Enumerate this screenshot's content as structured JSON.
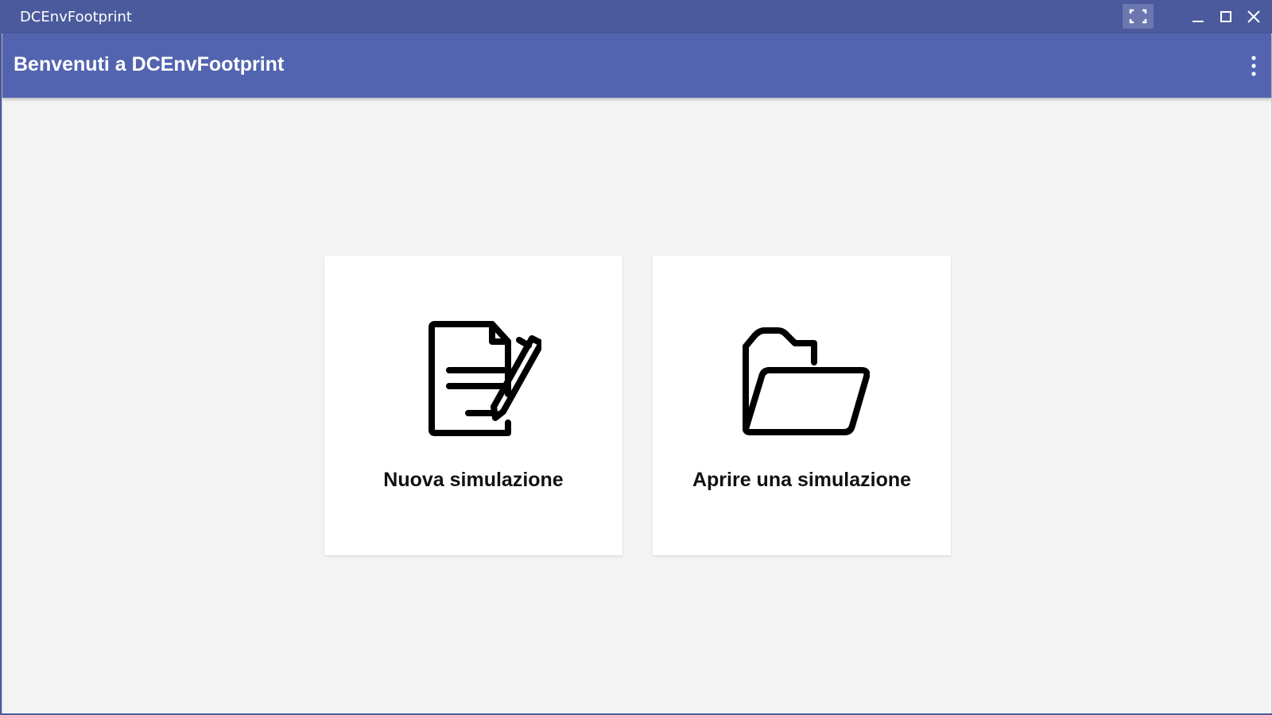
{
  "window": {
    "title": "DCEnvFootprint",
    "controls": {
      "fullscreen_icon": "fullscreen-icon",
      "minimize_icon": "minimize-icon",
      "maximize_icon": "maximize-icon",
      "close_icon": "close-icon"
    }
  },
  "appbar": {
    "title": "Benvenuti a DCEnvFootprint",
    "menu_icon": "more-vertical-icon"
  },
  "cards": [
    {
      "label": "Nuova simulazione",
      "icon": "document-edit-icon"
    },
    {
      "label": "Aprire una simulazione",
      "icon": "open-folder-icon"
    }
  ],
  "colors": {
    "titlebar": "#4a5a9c",
    "appbar": "#5264b0",
    "background": "#f3f3f3",
    "card": "#ffffff"
  }
}
